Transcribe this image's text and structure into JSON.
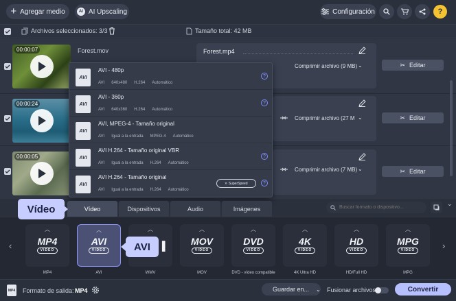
{
  "toolbar": {
    "add_media": "Agregar medio",
    "ai_upscaling": "AI Upscaling",
    "settings": "Configuración"
  },
  "selection": {
    "selected_label": "Archivos seleccionados: 3/3",
    "total_size_label": "Tamaño total: 42 MB"
  },
  "files": [
    {
      "duration": "00:00:07",
      "name": "Forest.mov",
      "output_name": "Forest.mp4",
      "compress": "Comprimir archivo (9 MB)",
      "edit": "Editar"
    },
    {
      "duration": "00:00:24",
      "compress": "Comprimir archivo (27 M",
      "edit": "Editar"
    },
    {
      "duration": "00:00:05",
      "compress": "Comprimir archivo (7 MB)",
      "edit": "Editar"
    }
  ],
  "preset_dropdown": {
    "items": [
      {
        "title": "AVI - 480p",
        "specs": [
          "AVI",
          "640x480",
          "H.264",
          "Automático"
        ],
        "superspeed": ""
      },
      {
        "title": "AVI - 360p",
        "specs": [
          "AVI",
          "640x360",
          "H.264",
          "Automático"
        ],
        "superspeed": ""
      },
      {
        "title": "AVI, MPEG-4 - Tamaño original",
        "specs": [
          "AVI",
          "Igual a la entrada",
          "MPEG-4",
          "Automático"
        ],
        "superspeed": ""
      },
      {
        "title": "AVI H.264 - Tamaño original VBR",
        "specs": [
          "AVI",
          "Igual a la entrada",
          "H.264",
          "Automático"
        ],
        "superspeed": ""
      },
      {
        "title": "AVI H.264 - Tamaño original",
        "specs": [
          "AVI",
          "Igual a la entrada",
          "H.264",
          "Automático"
        ],
        "superspeed": "SuperSpeed"
      }
    ],
    "help_glyph": "?"
  },
  "callouts": {
    "video": "Vídeo",
    "avi": "AVI"
  },
  "tabs": [
    "Vídeo",
    "Dispositivos",
    "Audio",
    "Imágenes"
  ],
  "search": {
    "placeholder": "Buscar formato o dispositivo..."
  },
  "formats": [
    {
      "logo": "MP4",
      "sub": "VIDEO",
      "label": "MP4"
    },
    {
      "logo": "AVI",
      "sub": "VIDEO",
      "label": "AVI"
    },
    {
      "logo": "",
      "sub": "",
      "label": "WMV"
    },
    {
      "logo": "MOV",
      "sub": "VIDEO",
      "label": "MOV"
    },
    {
      "logo": "DVD",
      "sub": "VIDEO",
      "label": "DVD - vídeo compatible"
    },
    {
      "logo": "4K",
      "sub": "VIDEO",
      "label": "4K Ultra HD"
    },
    {
      "logo": "HD",
      "sub": "VIDEO",
      "label": "HD/Full HD"
    },
    {
      "logo": "MPG",
      "sub": "VIDEO",
      "label": "MPG"
    }
  ],
  "bottom": {
    "output_format_label": "Formato de salida:",
    "output_format_value": "MP4",
    "save_to": "Guardar en...",
    "merge_label": "Fusionar archivos:",
    "convert": "Convertir"
  },
  "colors": {
    "background": "#2a303c",
    "accent": "#8b96ff",
    "callout": "#c7ceff",
    "convert_button": "#b7c0ff"
  }
}
